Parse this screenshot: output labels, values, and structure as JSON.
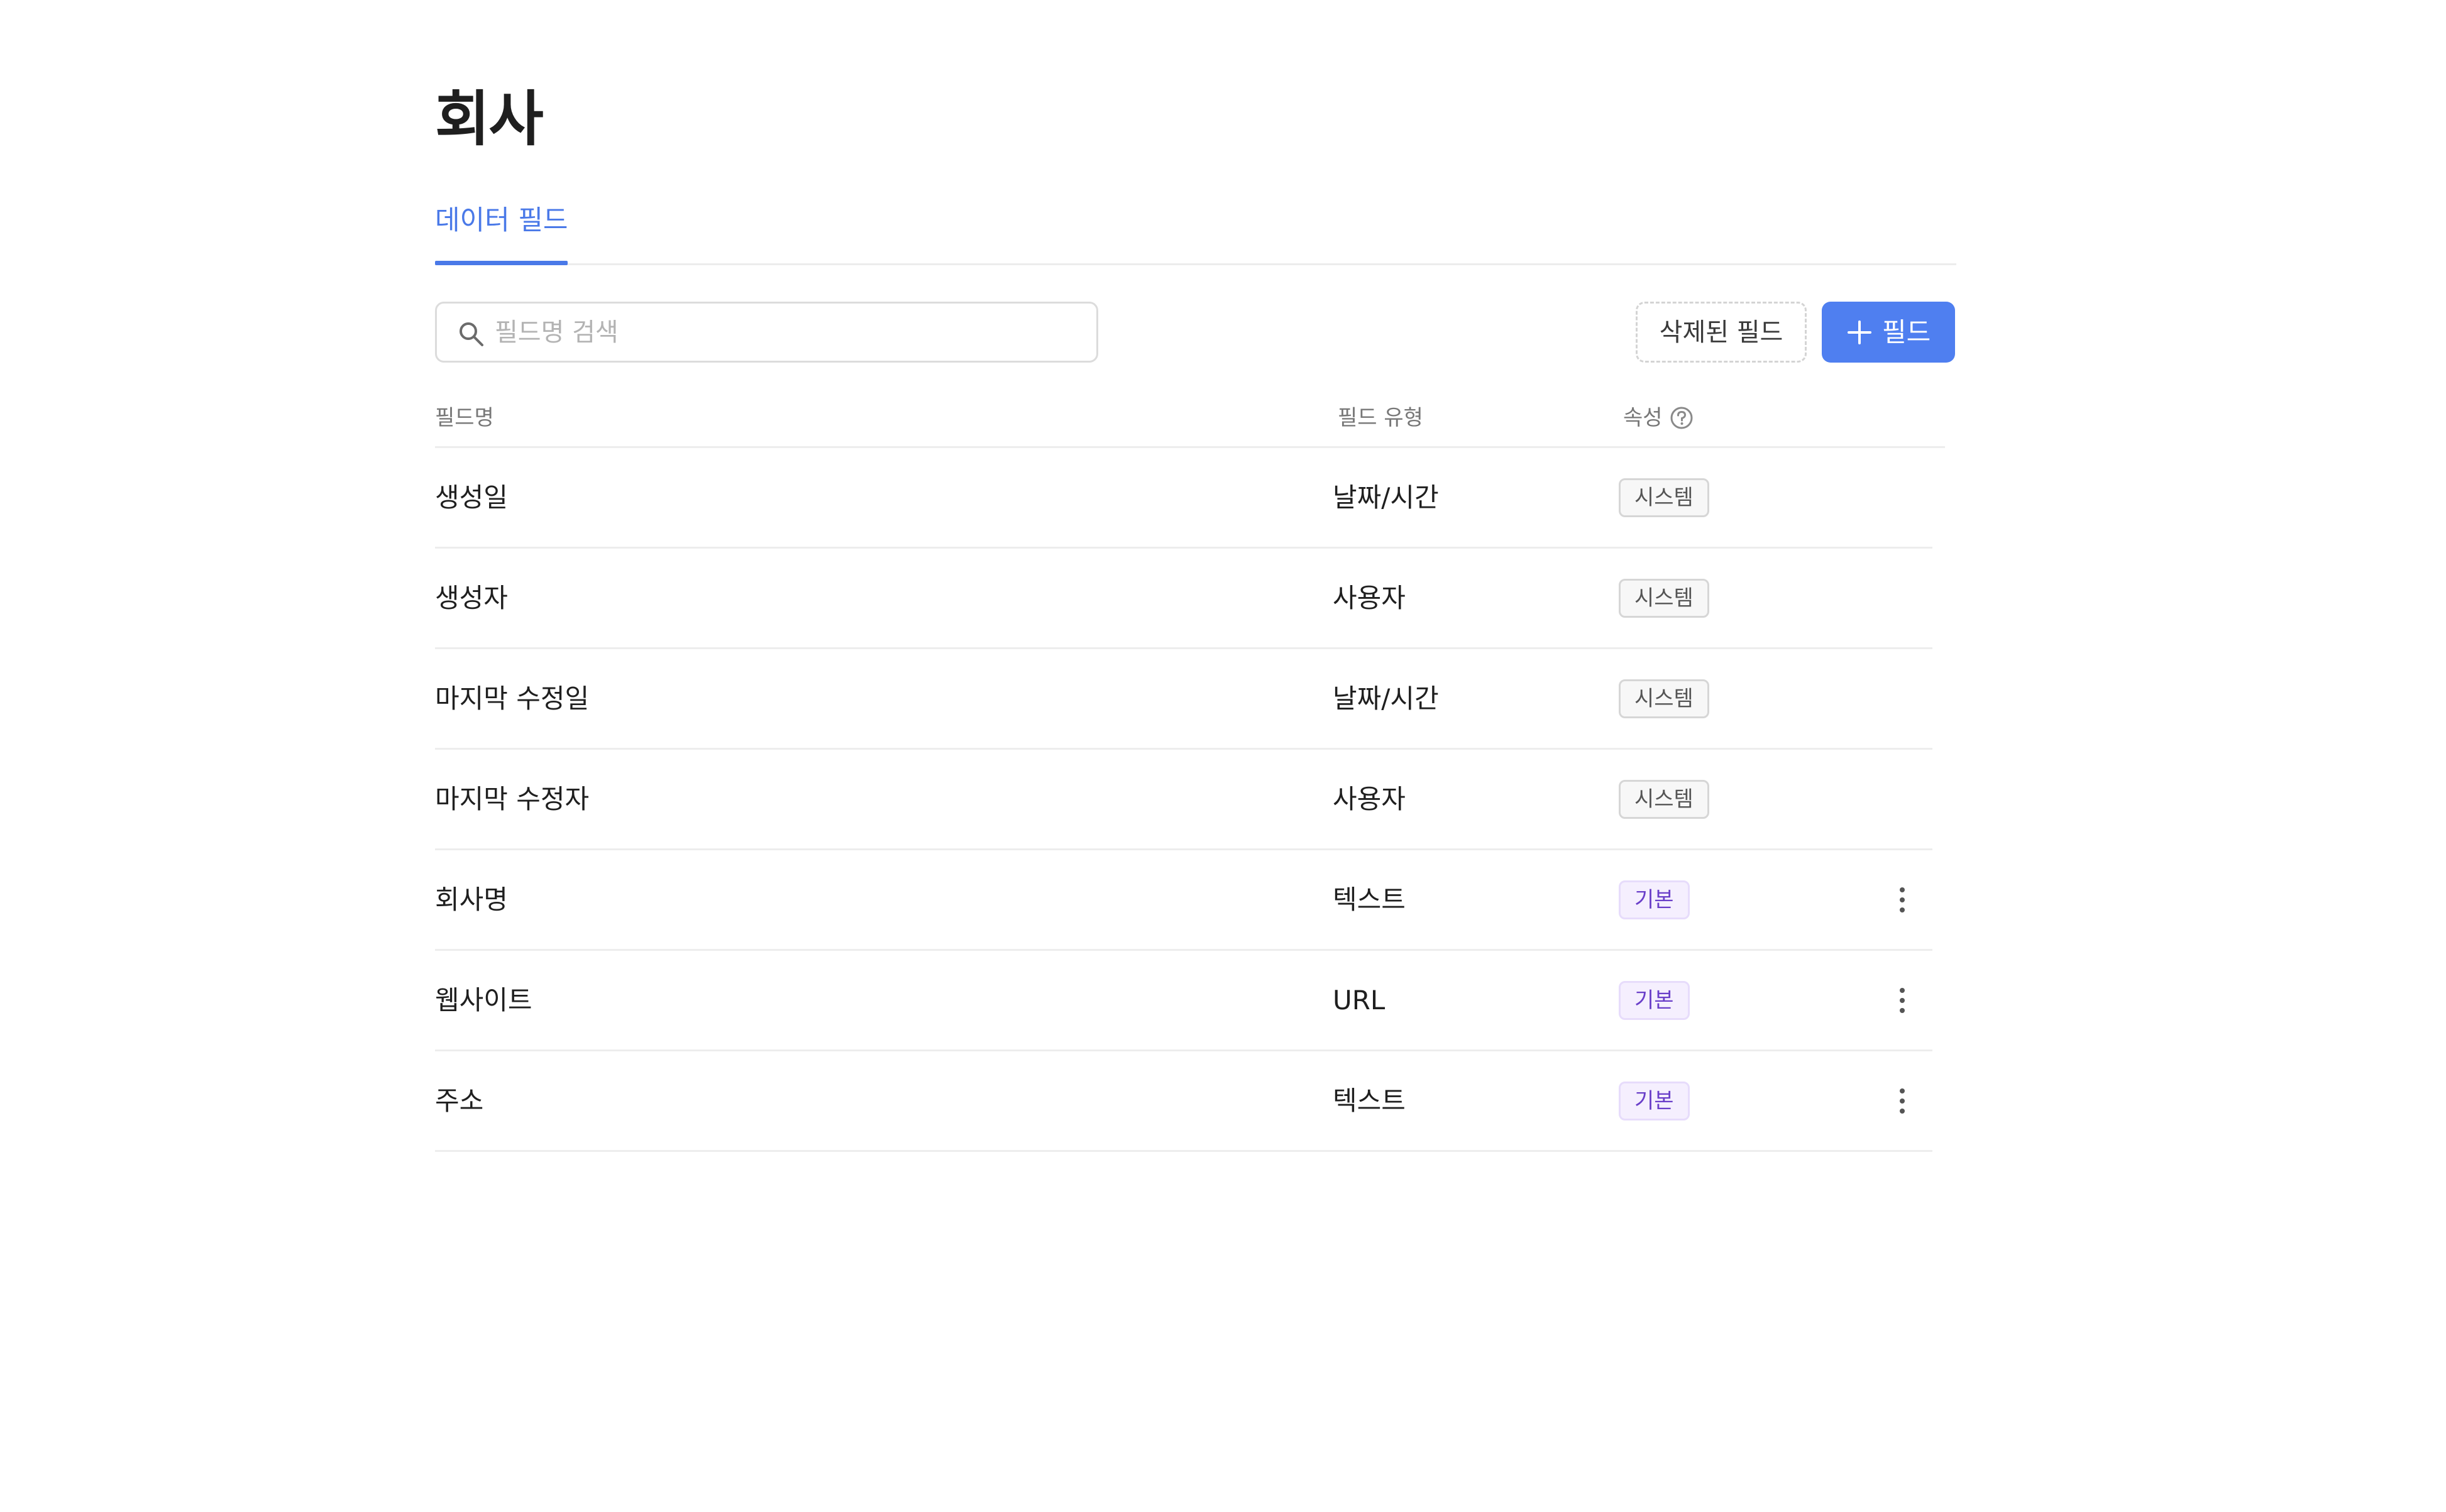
{
  "page": {
    "title": "회사"
  },
  "tabs": [
    {
      "label": "데이터 필드",
      "active": true
    }
  ],
  "search": {
    "placeholder": "필드명 검색",
    "value": ""
  },
  "toolbar": {
    "deleted_label": "삭제된 필드",
    "add_label": "필드"
  },
  "table": {
    "headers": {
      "name": "필드명",
      "type": "필드 유형",
      "attribute": "속성"
    },
    "rows": [
      {
        "name": "생성일",
        "type": "날짜/시간",
        "badge": "시스템",
        "badge_kind": "system",
        "menu": false
      },
      {
        "name": "생성자",
        "type": "사용자",
        "badge": "시스템",
        "badge_kind": "system",
        "menu": false
      },
      {
        "name": "마지막 수정일",
        "type": "날짜/시간",
        "badge": "시스템",
        "badge_kind": "system",
        "menu": false
      },
      {
        "name": "마지막 수정자",
        "type": "사용자",
        "badge": "시스템",
        "badge_kind": "system",
        "menu": false
      },
      {
        "name": "회사명",
        "type": "텍스트",
        "badge": "기본",
        "badge_kind": "basic",
        "menu": true
      },
      {
        "name": "웹사이트",
        "type": "URL",
        "badge": "기본",
        "badge_kind": "basic",
        "menu": true
      },
      {
        "name": "주소",
        "type": "텍스트",
        "badge": "기본",
        "badge_kind": "basic",
        "menu": true
      }
    ]
  },
  "icons": {
    "search": "search-icon",
    "add": "plus-icon",
    "help": "help-circle-icon",
    "more": "more-vertical-icon"
  },
  "colors": {
    "accent": "#4a79e8",
    "primary_button": "#4f7ff0",
    "badge_basic_text": "#6a3fc9",
    "badge_basic_bg": "#f5effe"
  }
}
